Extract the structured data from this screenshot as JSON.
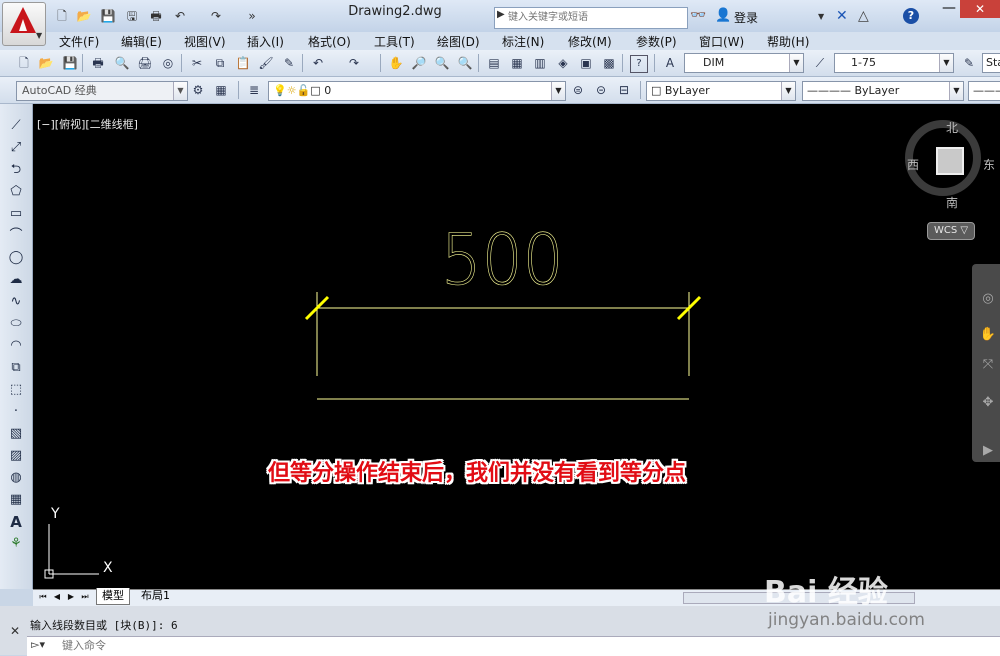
{
  "window": {
    "doc_title": "Drawing2.dwg",
    "search_placeholder": "键入关键字或短语",
    "login_label": "登录",
    "help_label": "?"
  },
  "menus": [
    "文件(F)",
    "编辑(E)",
    "视图(V)",
    "插入(I)",
    "格式(O)",
    "工具(T)",
    "绘图(D)",
    "标注(N)",
    "修改(M)",
    "参数(P)",
    "窗口(W)",
    "帮助(H)"
  ],
  "toolbar1": {
    "dim_style": "DIM",
    "scale": "1-75",
    "text_style_partial": "Sta"
  },
  "toolbar2": {
    "workspace": "AutoCAD 经典",
    "layer": "0",
    "color": "ByLayer",
    "linetype": "ByLayer"
  },
  "canvas": {
    "view_label": "[−][俯视][二维线框]",
    "dimension_text": "500",
    "compass": {
      "north": "北",
      "south": "南",
      "east": "东",
      "west": "西"
    },
    "wcs_label": "WCS ▽",
    "annotation": "但等分操作结束后，我们并没有看到等分点",
    "ucs_x": "X",
    "ucs_y": "Y",
    "colors": {
      "background": "#000000",
      "lines": "#ffff99",
      "ticks": "#ffff00",
      "annotation": "#e10c14"
    }
  },
  "tabs": {
    "model": "模型",
    "layout1": "布局1"
  },
  "command": {
    "history": "输入线段数目或 [块(B)]: 6",
    "input_placeholder": "键入命令"
  },
  "watermark": {
    "brand": "Bai  经验",
    "url": "jingyan.baidu.com"
  }
}
